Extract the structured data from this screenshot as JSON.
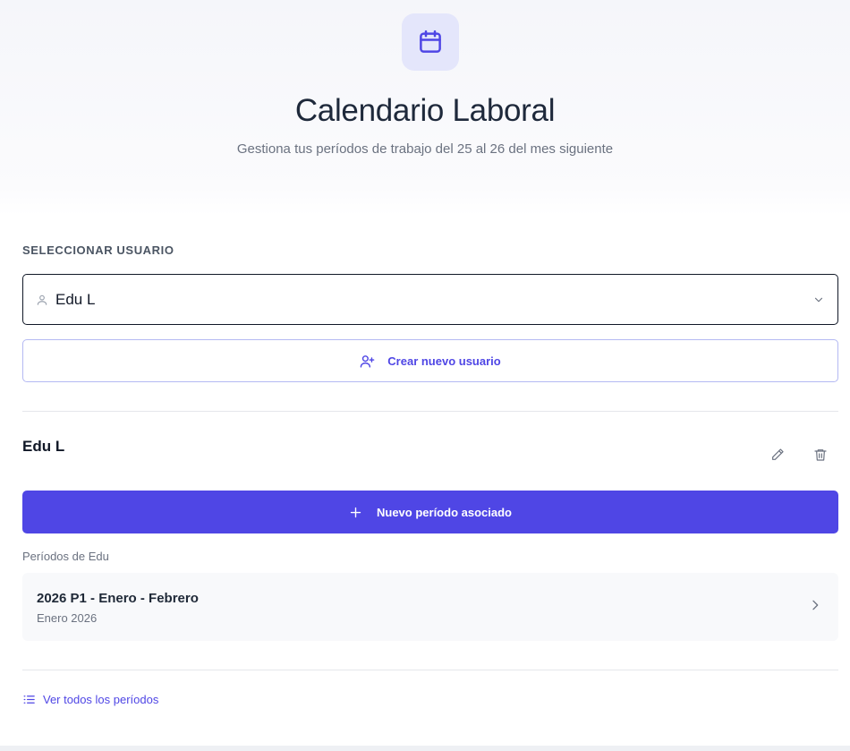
{
  "header": {
    "logo_icon": "calendar-icon",
    "title": "Calendario Laboral",
    "subtitle": "Gestiona tus períodos de trabajo del 25 al 26 del mes siguiente"
  },
  "user_selector": {
    "section_label": "SELECCIONAR USUARIO",
    "selected_value": "Edu L",
    "leading_icon": "user-icon",
    "trailing_icon": "chevron-down-icon"
  },
  "create_user": {
    "label": "Crear nuevo usuario",
    "icon": "user-plus-icon"
  },
  "user_panel": {
    "name": "Edu L",
    "edit_icon": "pencil-icon",
    "delete_icon": "trash-icon"
  },
  "new_period": {
    "label": "Nuevo período asociado",
    "icon": "plus-icon"
  },
  "periods": {
    "label": "Períodos de Edu",
    "items": [
      {
        "title": "2026 P1 - Enero - Febrero",
        "subtitle": "Enero 2026"
      }
    ]
  },
  "footer_link": {
    "label": "Ver todos los períodos",
    "icon": "list-icon"
  },
  "colors": {
    "accent": "#4f46e5",
    "accent_light": "#e4e6fb",
    "accent_border": "#b4b9f3"
  }
}
